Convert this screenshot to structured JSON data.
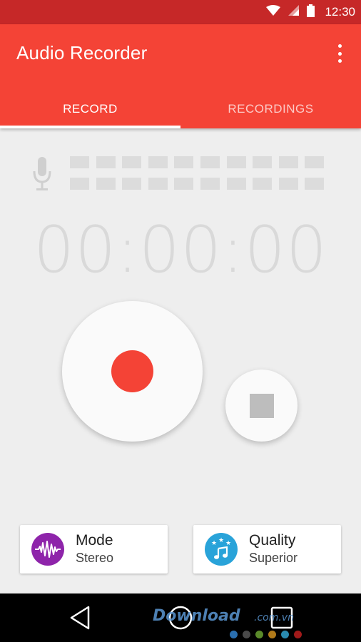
{
  "status_bar": {
    "time": "12:30",
    "icons": [
      "wifi-icon",
      "cell-signal-icon",
      "battery-icon"
    ]
  },
  "app_bar": {
    "title": "Audio Recorder",
    "overflow_icon": "more-vert-icon"
  },
  "tabs": [
    {
      "label": "RECORD",
      "selected": true
    },
    {
      "label": "RECORDINGS",
      "selected": false
    }
  ],
  "recorder": {
    "mic_icon": "microphone-icon",
    "level_meter_active": 0,
    "timer": "00:00:00",
    "record_button_icon": "record-dot-icon",
    "stop_button_icon": "stop-square-icon"
  },
  "settings": {
    "mode": {
      "title": "Mode",
      "value": "Stereo",
      "icon": "waveform-icon"
    },
    "quality": {
      "title": "Quality",
      "value": "Superior",
      "icon": "music-note-stars-icon"
    }
  },
  "nav_bar": {
    "buttons": [
      "back-icon",
      "home-icon",
      "recents-icon"
    ]
  },
  "watermark": {
    "text": "Download",
    "suffix": ".com.vn"
  },
  "colors": {
    "status_bar": "#c62828",
    "primary": "#f44336",
    "background": "#eeeeee",
    "mode_icon_bg": "#8e24aa",
    "quality_icon_bg": "#29a3d9"
  }
}
